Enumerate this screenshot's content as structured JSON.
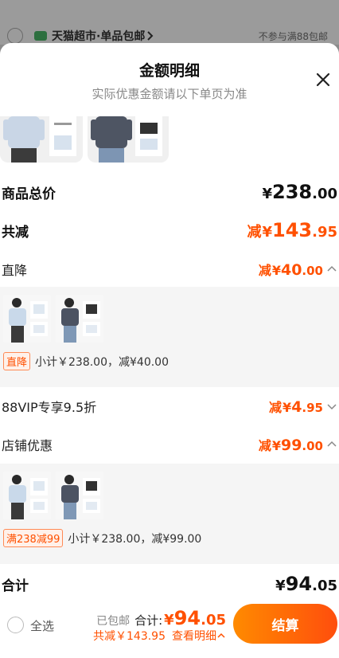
{
  "background": {
    "store_name": "天猫超市·单品包邮",
    "store_note": "不参与满88包邮"
  },
  "modal": {
    "title": "金额明细",
    "subtitle": "实际优惠金额请以下单页为准"
  },
  "summary": {
    "total_label": "商品总价",
    "total_symbol": "¥",
    "total_int": "238",
    "total_dec": ".00",
    "reduce_label": "共减",
    "reduce_prefix": "减",
    "reduce_symbol": "¥",
    "reduce_int": "143",
    "reduce_dec": ".95"
  },
  "discounts": [
    {
      "label": "直降",
      "prefix": "减",
      "symbol": "¥",
      "int": "40",
      "dec": ".00",
      "expanded": true,
      "tag": "直降",
      "subtotal": "小计￥238.00，减¥40.00"
    },
    {
      "label": "88VIP专享9.5折",
      "prefix": "减",
      "symbol": "¥",
      "int": "4",
      "dec": ".95",
      "expanded": false
    },
    {
      "label": "店铺优惠",
      "prefix": "减",
      "symbol": "¥",
      "int": "99",
      "dec": ".00",
      "expanded": true,
      "tag": "满238减99",
      "subtotal": "小计￥238.00，减¥99.00"
    }
  ],
  "grand": {
    "label": "合计",
    "symbol": "¥",
    "int": "94",
    "dec": ".05"
  },
  "bottom_bar": {
    "select_all": "全选",
    "free_shipping": "已包邮",
    "total_label": "合计:",
    "total_symbol": "¥",
    "total_int": "94",
    "total_dec": ".05",
    "reduce_text": "共减￥143.95",
    "detail_link": "查看明细",
    "checkout": "结算"
  },
  "colors": {
    "accent": "#ff5000",
    "checkout_start": "#ff8a00",
    "checkout_end": "#ff4e0d"
  }
}
